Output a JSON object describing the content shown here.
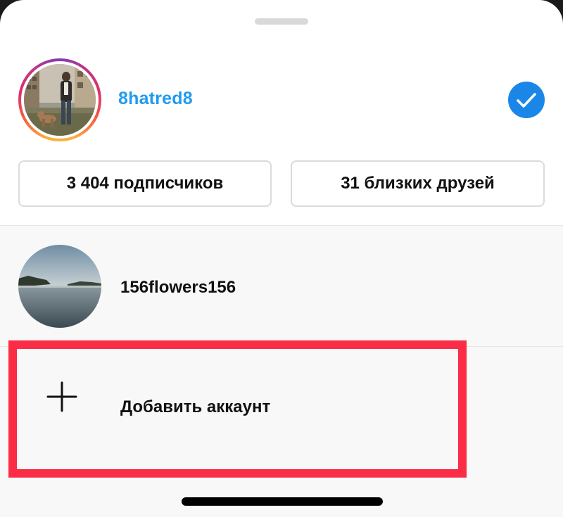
{
  "current_account": {
    "username": "8hatred8",
    "selected_icon": "checkmark-icon",
    "has_story_ring": true
  },
  "stats": {
    "followers_label": "3 404 подписчиков",
    "close_friends_label": "31 близких друзей"
  },
  "other_accounts": [
    {
      "username": "156flowers156"
    }
  ],
  "add_account": {
    "label": "Добавить аккаунт",
    "icon": "plus-icon"
  },
  "colors": {
    "username_current": "#1f9bf0",
    "check_badge": "#1a87e8",
    "highlight_border": "#fb2c45",
    "list_background": "#f8f8f8"
  }
}
